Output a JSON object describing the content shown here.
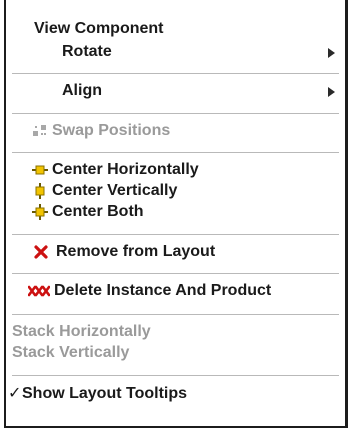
{
  "menu": {
    "title": "View Component",
    "rotate_label": "Rotate",
    "align_label": "Align",
    "swap_label": "Swap Positions",
    "center_h_label": "Center Horizontally",
    "center_v_label": "Center Vertically",
    "center_both_label": "Center Both",
    "remove_label": "Remove from Layout",
    "delete_label": "Delete Instance And Product",
    "stack_h_label": "Stack Horizontally",
    "stack_v_label": "Stack Vertically",
    "tooltips_check": "✓",
    "tooltips_label": "Show Layout Tooltips"
  },
  "icons": {
    "submenu": "submenu-arrow-icon",
    "swap": "swap-positions-icon",
    "center_h": "center-horizontally-icon",
    "center_v": "center-vertically-icon",
    "center_both": "center-both-icon",
    "remove": "red-x-icon",
    "delete": "red-triple-x-icon",
    "check": "checkmark-icon"
  },
  "colors": {
    "text": "#1a1a1a",
    "disabled": "#9a9a9a",
    "icon_yellow": "#f2c400",
    "icon_red": "#cc1111",
    "separator": "#b9b9b9"
  }
}
